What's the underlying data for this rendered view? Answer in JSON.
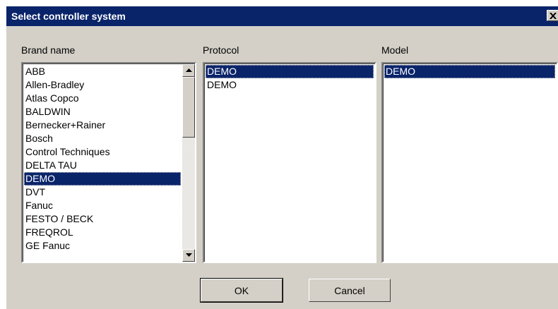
{
  "window": {
    "title": "Select controller system",
    "close_icon": "close-icon"
  },
  "brand": {
    "label": "Brand name",
    "selected": "DEMO",
    "items": [
      "ABB",
      "Allen-Bradley",
      "Atlas Copco",
      "BALDWIN",
      "Bernecker+Rainer",
      "Bosch",
      "Control Techniques",
      "DELTA TAU",
      "DEMO",
      "DVT",
      "Fanuc",
      "FESTO / BECK",
      "FREQROL",
      "GE Fanuc"
    ]
  },
  "protocol": {
    "label": "Protocol",
    "selected_index": 0,
    "items": [
      "DEMO",
      "DEMO"
    ]
  },
  "model": {
    "label": "Model",
    "selected_index": 0,
    "items": [
      "DEMO"
    ]
  },
  "buttons": {
    "ok": "OK",
    "cancel": "Cancel"
  },
  "colors": {
    "title_bar": "#0a246a",
    "dialog_face": "#d4d0c8",
    "selection": "#0a246a"
  }
}
